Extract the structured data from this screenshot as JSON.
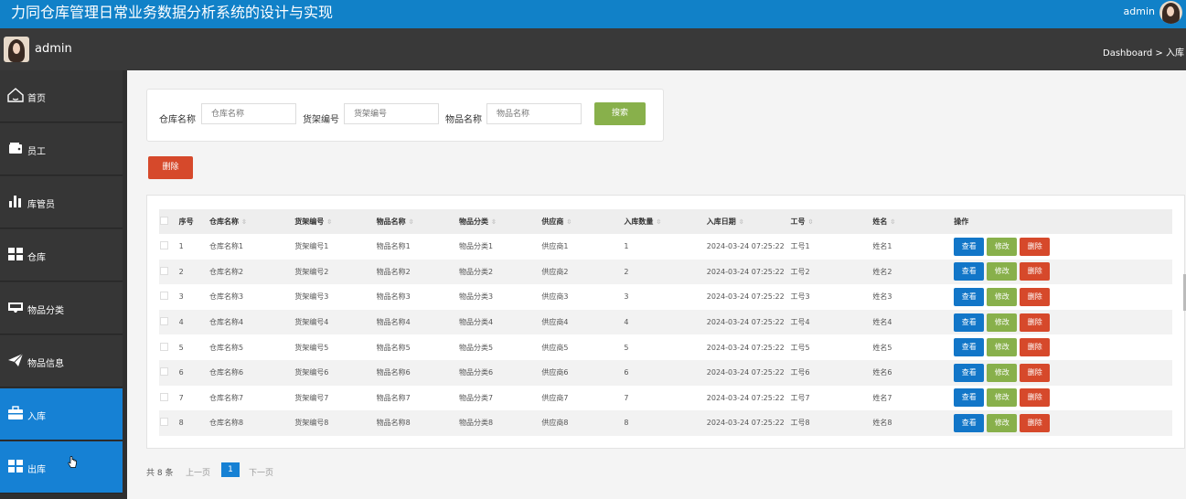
{
  "header": {
    "title": "力同仓库管理日常业务数据分析系统的设计与实现",
    "username": "admin"
  },
  "subbar": {
    "username": "admin",
    "breadcrumb": "Dashboard > 入库"
  },
  "sidebar": {
    "items": [
      {
        "label": "首页",
        "icon": "home-icon"
      },
      {
        "label": "员工",
        "icon": "wallet-icon"
      },
      {
        "label": "库管员",
        "icon": "bar-chart-icon"
      },
      {
        "label": "仓库",
        "icon": "grid-icon"
      },
      {
        "label": "物品分类",
        "icon": "inbox-icon"
      },
      {
        "label": "物品信息",
        "icon": "paper-plane-icon"
      },
      {
        "label": "入库",
        "icon": "briefcase-icon",
        "active": true
      },
      {
        "label": "出库",
        "icon": "grid-icon"
      }
    ]
  },
  "search": {
    "warehouse_label": "仓库名称",
    "warehouse_placeholder": "仓库名称",
    "shelf_label": "货架编号",
    "shelf_placeholder": "货架编号",
    "item_label": "物品名称",
    "item_placeholder": "物品名称",
    "search_button": "搜索"
  },
  "actions": {
    "delete_button": "删除"
  },
  "table": {
    "columns": [
      "序号",
      "仓库名称",
      "货架编号",
      "物品名称",
      "物品分类",
      "供应商",
      "入库数量",
      "入库日期",
      "工号",
      "姓名",
      "操作"
    ],
    "buttons": {
      "view": "查看",
      "edit": "修改",
      "delete": "删除"
    },
    "rows": [
      {
        "no": "1",
        "warehouse": "仓库名称1",
        "shelf": "货架编号1",
        "item": "物品名称1",
        "category": "物品分类1",
        "supplier": "供应商1",
        "qty": "1",
        "date": "2024-03-24 07:25:22",
        "emp_id": "工号1",
        "name": "姓名1"
      },
      {
        "no": "2",
        "warehouse": "仓库名称2",
        "shelf": "货架编号2",
        "item": "物品名称2",
        "category": "物品分类2",
        "supplier": "供应商2",
        "qty": "2",
        "date": "2024-03-24 07:25:22",
        "emp_id": "工号2",
        "name": "姓名2"
      },
      {
        "no": "3",
        "warehouse": "仓库名称3",
        "shelf": "货架编号3",
        "item": "物品名称3",
        "category": "物品分类3",
        "supplier": "供应商3",
        "qty": "3",
        "date": "2024-03-24 07:25:22",
        "emp_id": "工号3",
        "name": "姓名3"
      },
      {
        "no": "4",
        "warehouse": "仓库名称4",
        "shelf": "货架编号4",
        "item": "物品名称4",
        "category": "物品分类4",
        "supplier": "供应商4",
        "qty": "4",
        "date": "2024-03-24 07:25:22",
        "emp_id": "工号4",
        "name": "姓名4"
      },
      {
        "no": "5",
        "warehouse": "仓库名称5",
        "shelf": "货架编号5",
        "item": "物品名称5",
        "category": "物品分类5",
        "supplier": "供应商5",
        "qty": "5",
        "date": "2024-03-24 07:25:22",
        "emp_id": "工号5",
        "name": "姓名5"
      },
      {
        "no": "6",
        "warehouse": "仓库名称6",
        "shelf": "货架编号6",
        "item": "物品名称6",
        "category": "物品分类6",
        "supplier": "供应商6",
        "qty": "6",
        "date": "2024-03-24 07:25:22",
        "emp_id": "工号6",
        "name": "姓名6"
      },
      {
        "no": "7",
        "warehouse": "仓库名称7",
        "shelf": "货架编号7",
        "item": "物品名称7",
        "category": "物品分类7",
        "supplier": "供应商7",
        "qty": "7",
        "date": "2024-03-24 07:25:22",
        "emp_id": "工号7",
        "name": "姓名7"
      },
      {
        "no": "8",
        "warehouse": "仓库名称8",
        "shelf": "货架编号8",
        "item": "物品名称8",
        "category": "物品分类8",
        "supplier": "供应商8",
        "qty": "8",
        "date": "2024-03-24 07:25:22",
        "emp_id": "工号8",
        "name": "姓名8"
      }
    ]
  },
  "pagination": {
    "total": "共 8 条",
    "prev": "上一页",
    "current": "1",
    "next": "下一页"
  },
  "colors": {
    "header_blue": "#1181c8",
    "sidebar_dark": "#363636",
    "active_blue": "#1681d4",
    "search_green": "#88b04b",
    "delete_red": "#d6492b",
    "view_blue": "#1276c8"
  }
}
